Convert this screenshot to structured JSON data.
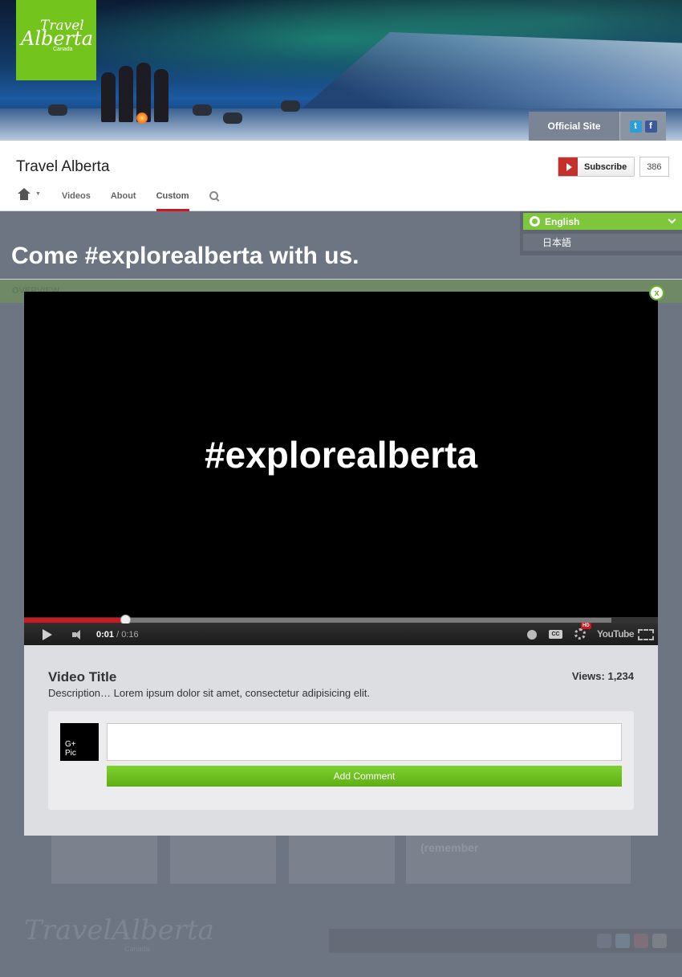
{
  "banner": {
    "logo_line1": "Travel",
    "logo_line2": "Alberta",
    "logo_line3": "Canada",
    "official_site": "Official Site",
    "brand_color": "#73c41d"
  },
  "channel": {
    "title": "Travel Alberta",
    "subscribe_label": "Subscribe",
    "subscriber_count": "386",
    "tabs": [
      {
        "label": "Videos"
      },
      {
        "label": "About"
      },
      {
        "label": "Custom",
        "active": true
      }
    ]
  },
  "page": {
    "headline": "Come #explorealberta with us.",
    "strip_label": "OVERVIEW",
    "thumb_caption": "(remember"
  },
  "language": {
    "selected": "English",
    "options": [
      "日本語"
    ]
  },
  "player": {
    "overlay_text": "#explorealberta",
    "current_time": "0:01",
    "duration": "/ 0:16",
    "progress_fraction": 0.16,
    "hd_badge": "HD",
    "cc_label": "CC",
    "brand_label": "YouTube"
  },
  "video_info": {
    "title": "Video Title",
    "views": "Views: 1,234",
    "description": "Description… Lorem ipsum dolor sit amet, consectetur adipisicing elit."
  },
  "comment": {
    "avatar_line1": "G+",
    "avatar_line2": "Pic",
    "input_value": "",
    "button_label": "Add Comment"
  },
  "close_label": "x",
  "footer": {
    "logo": "TravelAlberta",
    "sub": "Canada"
  },
  "icons": [
    "home-icon",
    "search-icon",
    "globe-icon",
    "twitter-icon",
    "facebook-icon",
    "play-icon",
    "volume-icon",
    "clock-icon",
    "gear-icon",
    "fullscreen-icon",
    "close-icon"
  ]
}
